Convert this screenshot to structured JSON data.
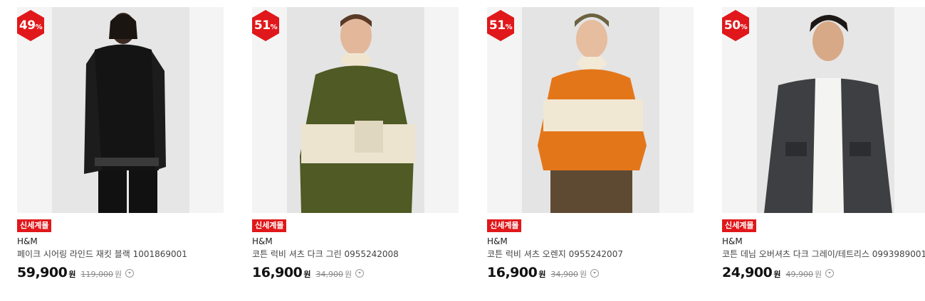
{
  "products": [
    {
      "discount": "49",
      "pct": "%",
      "tag": "신세계몰",
      "brand": "H&M",
      "name": "페이크 시어링 라인드 재킷 블랙 1001869001",
      "price": "59,900",
      "won": "원",
      "orig": "119,000",
      "won2": "원"
    },
    {
      "discount": "51",
      "pct": "%",
      "tag": "신세계몰",
      "brand": "H&M",
      "name": "코튼 럭비 셔츠 다크 그린 0955242008",
      "price": "16,900",
      "won": "원",
      "orig": "34,900",
      "won2": "원"
    },
    {
      "discount": "51",
      "pct": "%",
      "tag": "신세계몰",
      "brand": "H&M",
      "name": "코튼 럭비 셔츠 오렌지 0955242007",
      "price": "16,900",
      "won": "원",
      "orig": "34,900",
      "won2": "원"
    },
    {
      "discount": "50",
      "pct": "%",
      "tag": "신세계몰",
      "brand": "H&M",
      "name": "코튼 데님 오버셔츠 다크 그레이/테트리스 0993989001",
      "price": "24,900",
      "won": "원",
      "orig": "49,900",
      "won2": "원"
    }
  ],
  "colors": {
    "badge": "#e0181b",
    "tag": "#e0181b"
  },
  "icons": [
    "discount-badge-icon",
    "info-dropdown-icon"
  ]
}
